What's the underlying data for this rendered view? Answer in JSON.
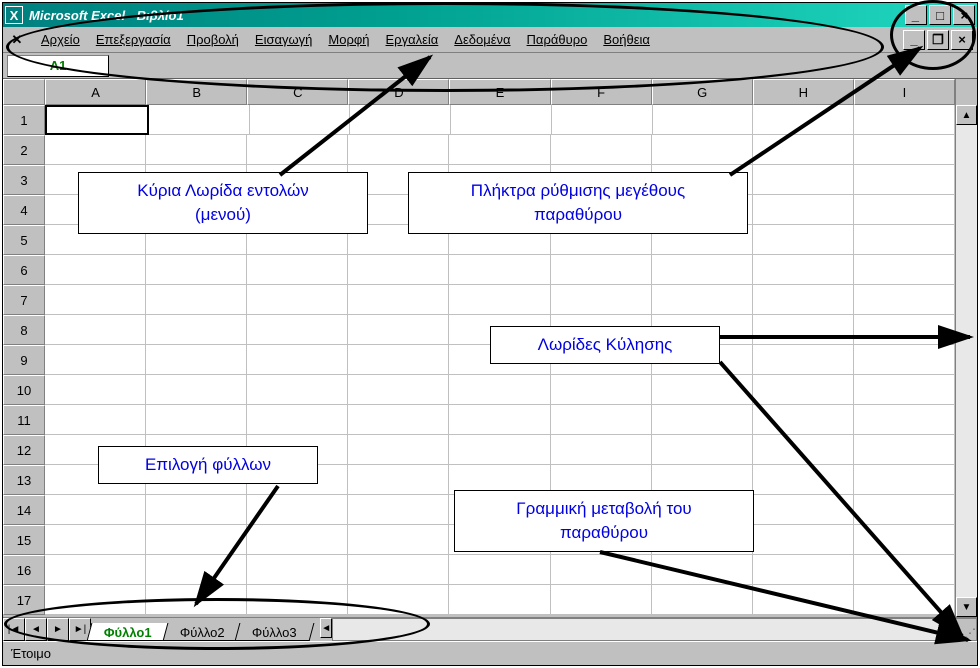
{
  "window": {
    "title": "Microsoft Excel - Βιβλίο1",
    "app_icon_glyph": "X",
    "controls": {
      "min": "_",
      "max": "□",
      "close": "×"
    }
  },
  "menus": {
    "sys_glyph": "✕",
    "items": [
      "Αρχείο",
      "Επεξεργασία",
      "Προβολή",
      "Εισαγωγή",
      "Μορφή",
      "Εργαλεία",
      "Δεδομένα",
      "Παράθυρο",
      "Βοήθεια"
    ],
    "sub_controls": {
      "min": "_",
      "restore": "❐",
      "close": "×"
    }
  },
  "formula": {
    "name_box": "A1"
  },
  "grid": {
    "columns": [
      "A",
      "B",
      "C",
      "D",
      "E",
      "F",
      "G",
      "H",
      "I"
    ],
    "rows": [
      "1",
      "2",
      "3",
      "4",
      "5",
      "6",
      "7",
      "8",
      "9",
      "10",
      "11",
      "12",
      "13",
      "14",
      "15",
      "16",
      "17"
    ],
    "active": "A1"
  },
  "sheets": {
    "nav": {
      "first": "|◄",
      "prev": "◄",
      "next": "►",
      "last": "►|"
    },
    "tabs": [
      "Φύλλο1",
      "Φύλλο2",
      "Φύλλο3"
    ],
    "active": 0
  },
  "status": {
    "text": "Έτοιμο"
  },
  "scroll": {
    "up": "▲",
    "down": "▼",
    "left": "◄",
    "right": "►"
  },
  "callouts": {
    "menu": "Κύρια Λωρίδα εντολών\n(μενού)",
    "winbtns": "Πλήκτρα ρύθμισης μεγέθους\nπαραθύρου",
    "scrollbars": "Λωρίδες Κύλησης",
    "sheets": "Επιλογή φύλλων",
    "resize": "Γραμμική μεταβολή του\nπαραθύρου"
  }
}
